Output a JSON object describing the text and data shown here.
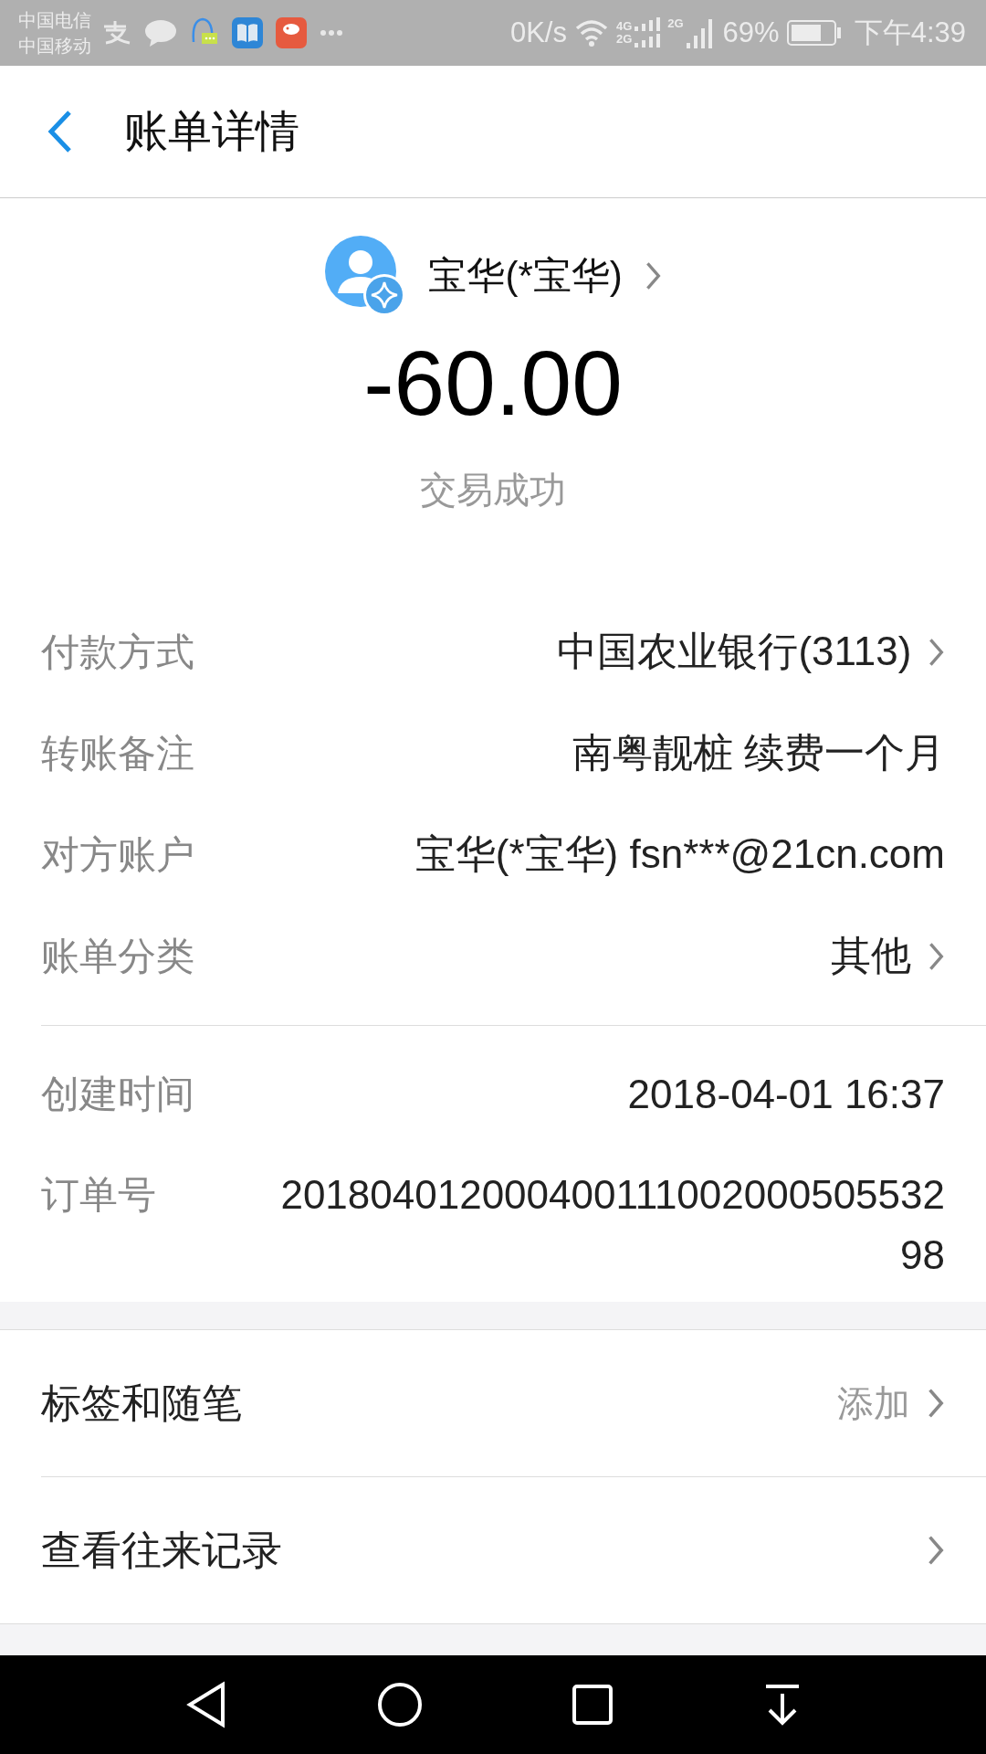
{
  "status_bar": {
    "carriers": [
      "中国电信",
      "中国移动"
    ],
    "speed": "0K/s",
    "signal_labels": [
      "4G",
      "2G",
      "2G"
    ],
    "battery": "69%",
    "time": "下午4:39"
  },
  "header": {
    "title": "账单详情"
  },
  "summary": {
    "name": "宝华(*宝华)",
    "amount": "-60.00",
    "status": "交易成功"
  },
  "details": [
    {
      "label": "付款方式",
      "value": "中国农业银行(3113)",
      "has_arrow": true
    },
    {
      "label": "转账备注",
      "value": "南粤靓桩 续费一个月",
      "has_arrow": false
    },
    {
      "label": "对方账户",
      "value": "宝华(*宝华) fsn***@21cn.com",
      "has_arrow": false
    },
    {
      "label": "账单分类",
      "value": "其他",
      "has_arrow": true
    }
  ],
  "meta": [
    {
      "label": "创建时间",
      "value": "2018-04-01 16:37"
    },
    {
      "label": "订单号",
      "value": "20180401200040011100200050553298"
    }
  ],
  "actions": [
    {
      "label": "标签和随笔",
      "value": "添加"
    },
    {
      "label": "查看往来记录"
    }
  ]
}
